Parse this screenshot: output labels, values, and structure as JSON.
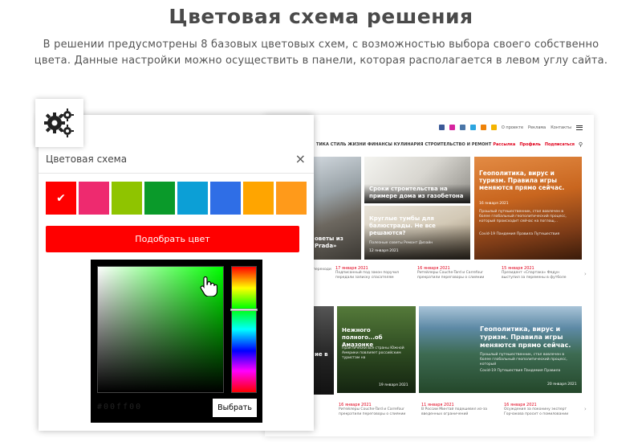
{
  "header": {
    "title": "Цветовая схема решения",
    "description": "В решении предусмотрены 8 базовых цветовых схем, с возможностью выбора своего собственно цвета. Данные настройки можно осуществить в панели, которая располагается в левом углу сайта."
  },
  "panel": {
    "title": "Цветовая схема",
    "close_label": "×",
    "gear_icon": "gears-icon",
    "swatches": [
      {
        "color": "#ff0000",
        "selected": true
      },
      {
        "color": "#ee2a6f",
        "selected": false
      },
      {
        "color": "#8fc400",
        "selected": false
      },
      {
        "color": "#0a9a2a",
        "selected": false
      },
      {
        "color": "#0c9fd6",
        "selected": false
      },
      {
        "color": "#2f6ee6",
        "selected": false
      },
      {
        "color": "#ffa500",
        "selected": false
      },
      {
        "color": "#ff9a1a",
        "selected": false
      }
    ],
    "selected_check": "✔",
    "pick_button": "Подобрать цвет",
    "picker": {
      "hex_value": "#00ff00",
      "choose_button": "Выбрать"
    }
  },
  "site": {
    "top_links": [
      "О проекте",
      "Реклама",
      "Контакты"
    ],
    "nav": "ТИКА   СТИЛЬ ЖИЗНИ   ФИНАНСЫ   КУЛИНАРИЯ   СТРОИТЕЛЬСТВО И РЕМОНТ",
    "user_links": [
      "Рассылка",
      "Профиль",
      "Подписаться"
    ],
    "tiles": {
      "building": "Сроки строительства на примере дома из газобетона",
      "tumbs": "Круглые тумбы для балюстрады. Не все решаются?",
      "tumbs_tags": "Полезные советы  Ремонт  Дизайн",
      "tumbs_date": "12 января 2021",
      "geo_title": "Геополитика, вирус и туризм. Правила игры меняются прямо сейчас.",
      "geo_date": "16 января 2021",
      "geo_text": "Прошлый путешественник, стал вовлечен в более глобальный геополитический процесс, который происходит сейчас на поглощ...",
      "geo_tags": "Covid-19  Пандемия  Правила  Путешествия",
      "street": "оветы из Prada»",
      "amazon_title": "Нежного полного...об Амазонке",
      "amazon_text": "Практически все страны Южной Америки повлияет российским туристам на",
      "amazon_date": "19 января 2021",
      "geo2_title": "Геополитика, вирус и туризм. Правила игры меняются прямо сейчас.",
      "geo2_text": "Прошлый путешественник, стал вовлечен в более глобальный геополитический процесс, который",
      "geo2_tags": "Covid-19  Путешествия  Пандемия  Правила",
      "geo2_date": "20 января 2021"
    },
    "captions_row1": [
      {
        "date": "",
        "text": "переходи"
      },
      {
        "date": "17 января 2021",
        "text": "Подписанный под закон поручил передали записку спасателям"
      },
      {
        "date": "16 января 2021",
        "text": "Ритейлеры Couche-Tard и Carrefour прекратили переговоры о слиянии"
      },
      {
        "date": "15 января 2021",
        "text": "Президент «Спартака» Федун выступил за перемены в футболе"
      }
    ],
    "captions_row2": [
      {
        "date": "",
        "text": "переходи"
      },
      {
        "date": "16 января 2021",
        "text": "Ритейлеры Couche-Tard и Carrefour прекратили переговоры о слиянии"
      },
      {
        "date": "11 января 2021",
        "text": "В России Минтай подешевел из-за введенных ограничений"
      },
      {
        "date": "16 января 2021",
        "text": "Осуждения за поконину эксперт Горчакова просит о помиловании"
      }
    ],
    "side_fragments": [
      "ие в",
      "м"
    ]
  }
}
